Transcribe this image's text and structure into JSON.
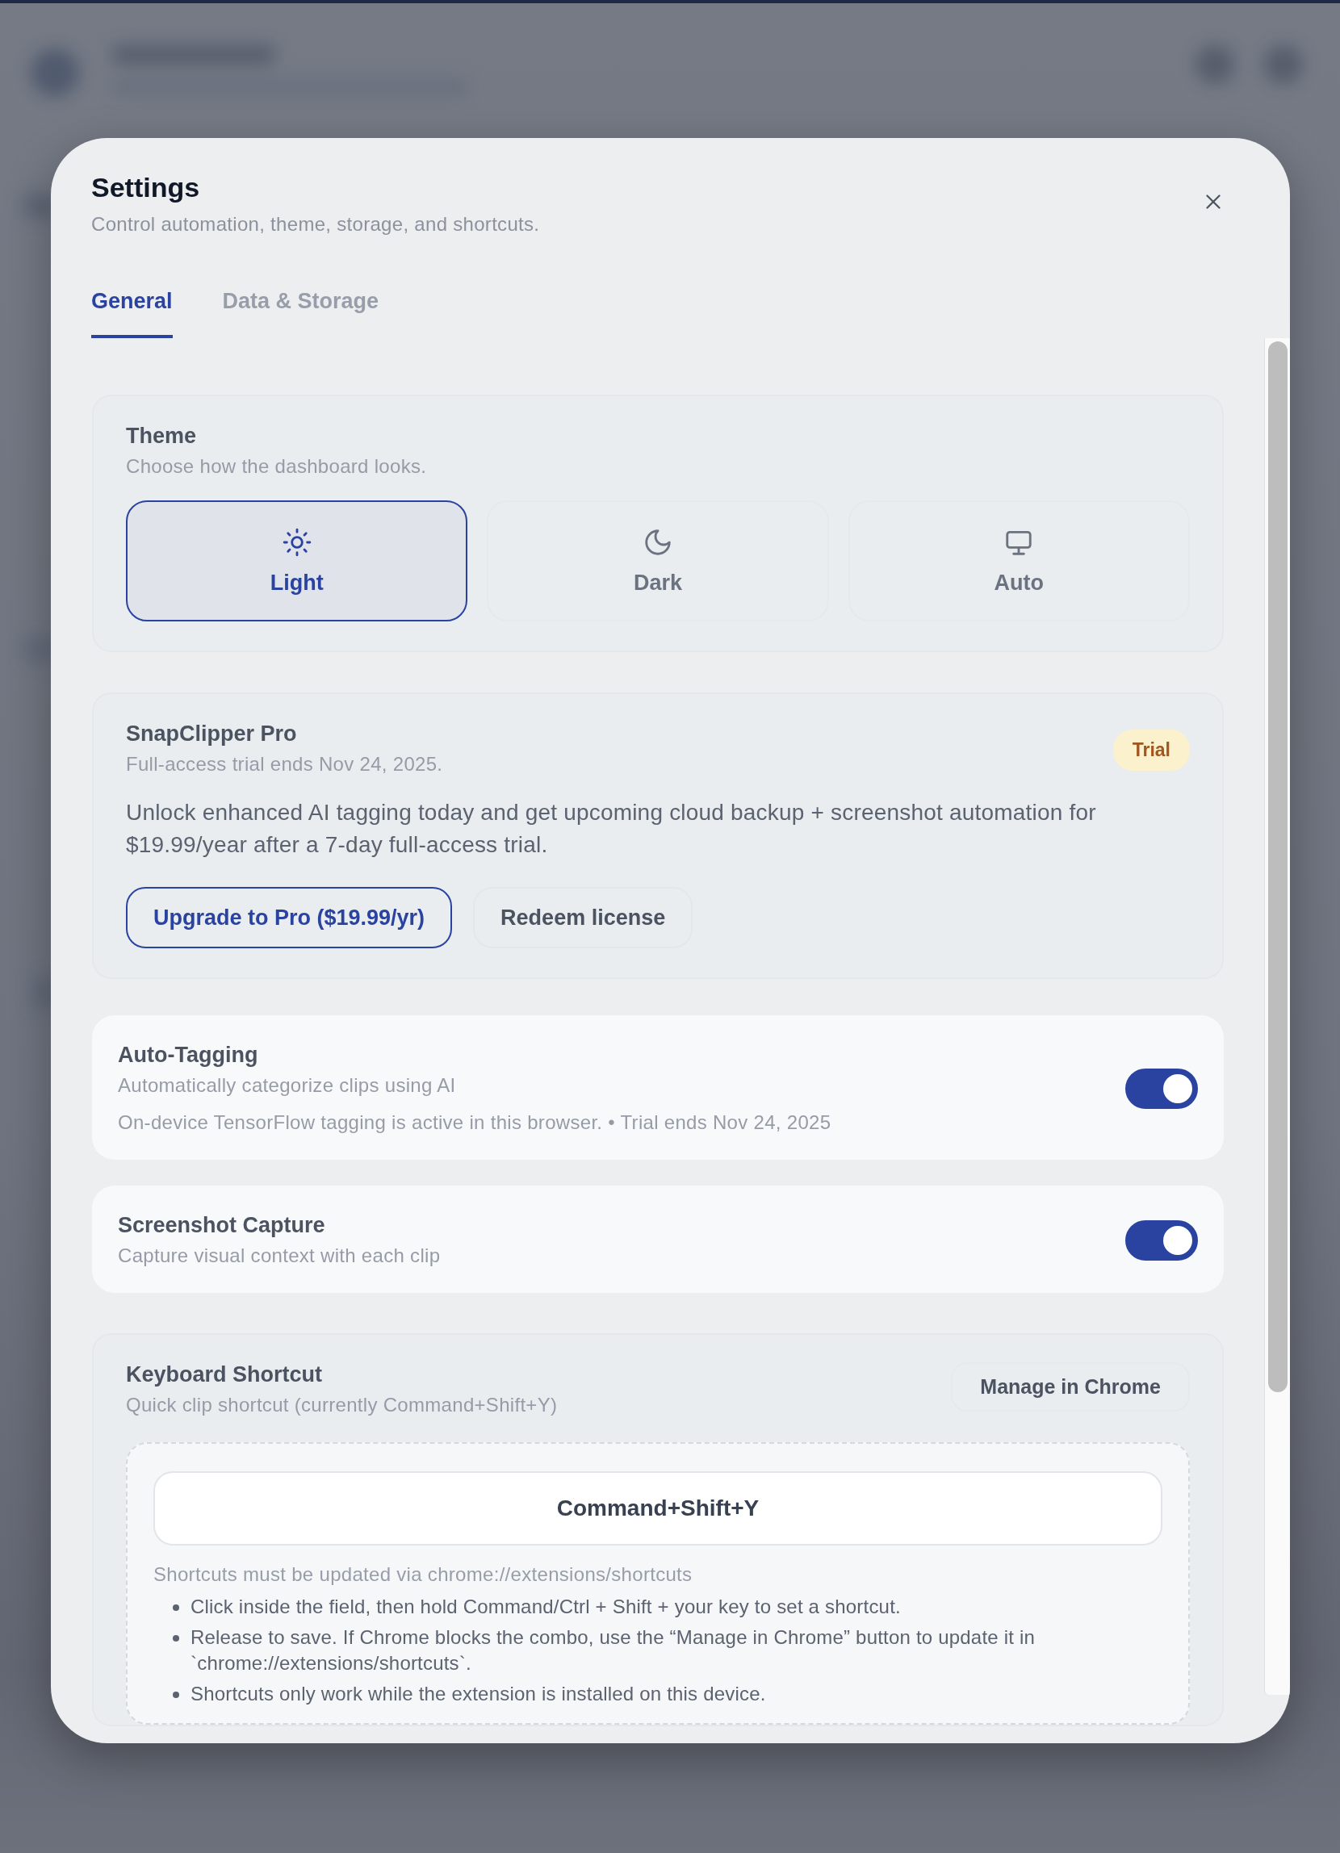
{
  "dialog": {
    "title": "Settings",
    "subtitle": "Control automation, theme, storage, and shortcuts."
  },
  "tabs": [
    {
      "label": "General",
      "selected": true
    },
    {
      "label": "Data & Storage",
      "selected": false
    }
  ],
  "theme": {
    "title": "Theme",
    "description": "Choose how the dashboard looks.",
    "options": [
      {
        "label": "Light",
        "kind": "sun",
        "selected": true
      },
      {
        "label": "Dark",
        "kind": "moon",
        "selected": false
      },
      {
        "label": "Auto",
        "kind": "monitor",
        "selected": false
      }
    ]
  },
  "pro": {
    "title": "SnapClipper Pro",
    "subtitle": "Full-access trial ends Nov 24, 2025.",
    "badge": "Trial",
    "body": "Unlock enhanced AI tagging today and get upcoming cloud backup + screenshot automation for $19.99/year after a 7-day full-access trial.",
    "buttons": [
      {
        "label": "Upgrade to Pro ($19.99/yr)",
        "kind": "primary"
      },
      {
        "label": "Redeem license",
        "kind": "secondary"
      }
    ]
  },
  "toggles": [
    {
      "title": "Auto-Tagging",
      "description": "Automatically categorize clips using AI",
      "note": "On-device TensorFlow tagging is active in this browser. • Trial ends Nov 24, 2025",
      "on": true
    },
    {
      "title": "Screenshot Capture",
      "description": "Capture visual context with each clip",
      "on": true
    }
  ],
  "shortcut": {
    "title": "Keyboard Shortcut",
    "description": "Quick clip shortcut (currently Command+Shift+Y)",
    "button": "Manage in Chrome",
    "value": "Command+Shift+Y",
    "hint": "Shortcuts must be updated via chrome://extensions/shortcuts",
    "tips": [
      "Click inside the field, then hold Command/Ctrl + Shift + your key to set a shortcut.",
      "Release to save. If Chrome blocks the combo, use the “Manage in Chrome” button to update it in `chrome://extensions/shortcuts`.",
      "Shortcuts only work while the extension is installed on this device."
    ]
  }
}
